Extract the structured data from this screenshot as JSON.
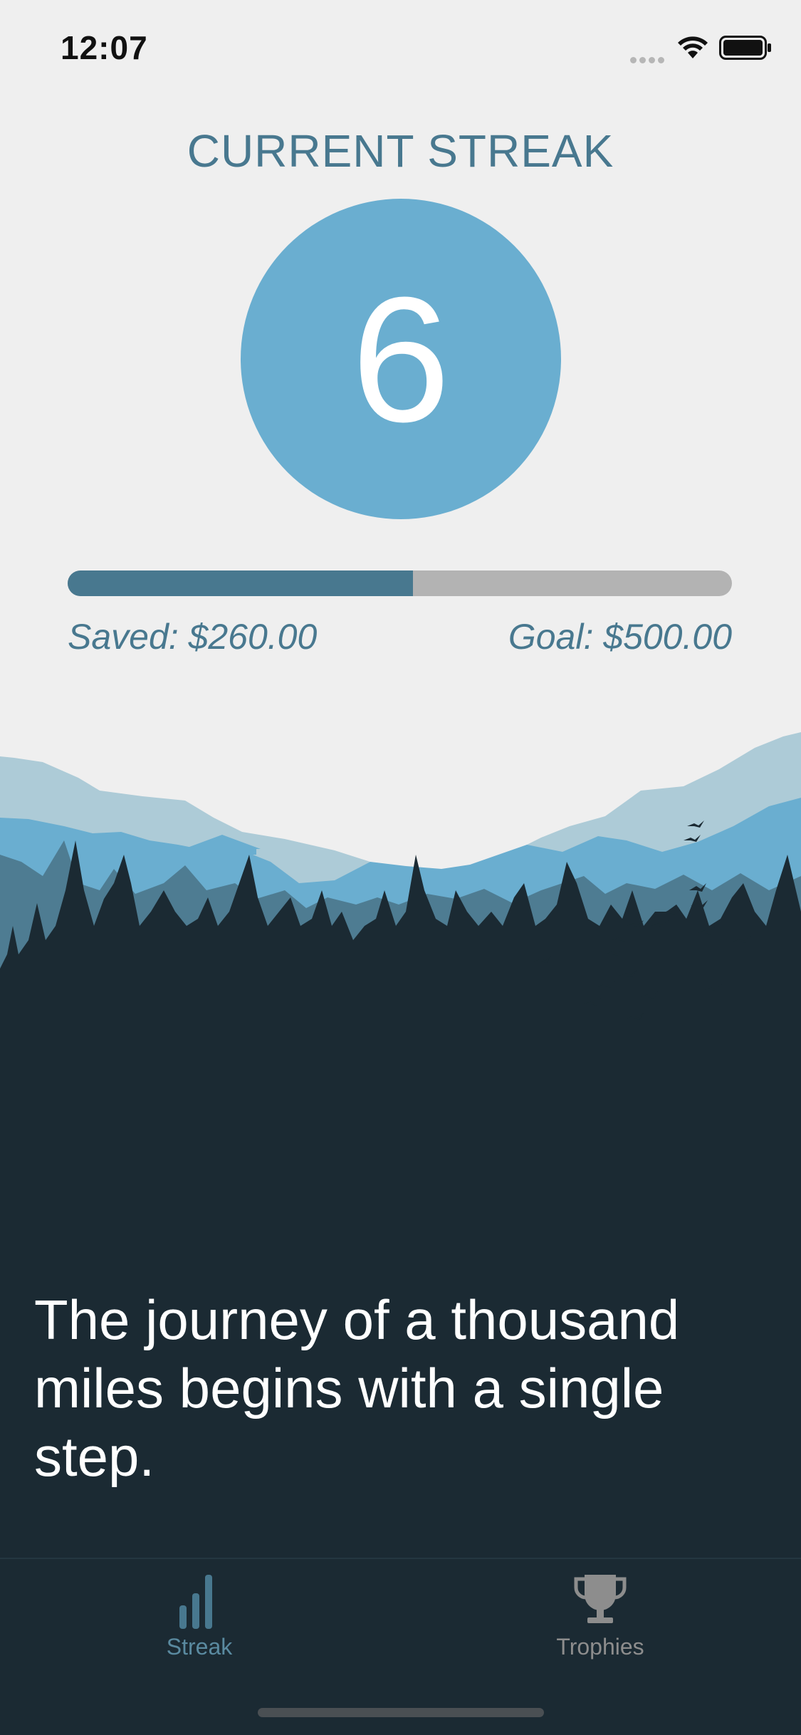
{
  "status_bar": {
    "time": "12:07"
  },
  "streak": {
    "title": "CURRENT STREAK",
    "count": "6"
  },
  "savings": {
    "saved_label": "Saved: $260.00",
    "goal_label": "Goal: $500.00",
    "progress_fraction": 0.52
  },
  "quote": "The journey of a thousand miles begins with a single step.",
  "tabs": [
    {
      "label": "Streak",
      "icon": "bar-chart-icon",
      "active": true
    },
    {
      "label": "Trophies",
      "icon": "trophy-icon",
      "active": false
    }
  ],
  "colors": {
    "background": "#efefef",
    "accent": "#48788f",
    "circle": "#6aaed0",
    "dark": "#1b2a33",
    "track": "#b3b3b3"
  }
}
